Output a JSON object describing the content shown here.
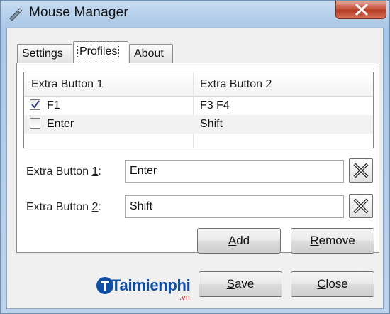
{
  "window": {
    "title": "Mouse Manager",
    "close_glyph": "×"
  },
  "tabs": [
    {
      "label": "Settings",
      "active": false
    },
    {
      "label": "Profiles",
      "active": true
    },
    {
      "label": "About",
      "active": false
    }
  ],
  "list": {
    "columns": [
      "Extra Button 1",
      "Extra Button 2"
    ],
    "rows": [
      {
        "checked": true,
        "button1": "F1",
        "button2": "F3 F4"
      },
      {
        "checked": false,
        "button1": "Enter",
        "button2": "Shift"
      }
    ]
  },
  "fields": {
    "extra1": {
      "label_prefix": "Extra Button ",
      "label_key": "1",
      "label_suffix": ":",
      "value": "Enter"
    },
    "extra2": {
      "label_prefix": "Extra Button ",
      "label_key": "2",
      "label_suffix": ":",
      "value": "Shift"
    }
  },
  "buttons": {
    "add": {
      "key": "A",
      "rest": "dd"
    },
    "remove": {
      "key": "R",
      "rest": "emove"
    },
    "save": {
      "key": "S",
      "rest": "ave"
    },
    "close": {
      "key": "C",
      "rest": "lose"
    }
  },
  "watermark": {
    "text": "Taimienphi",
    "suffix": ".vn"
  },
  "colors": {
    "title_bar": "#a9c6e6",
    "close_button": "#c7543d",
    "watermark_blue": "#0f4fa3",
    "watermark_red": "#d11f1f"
  }
}
